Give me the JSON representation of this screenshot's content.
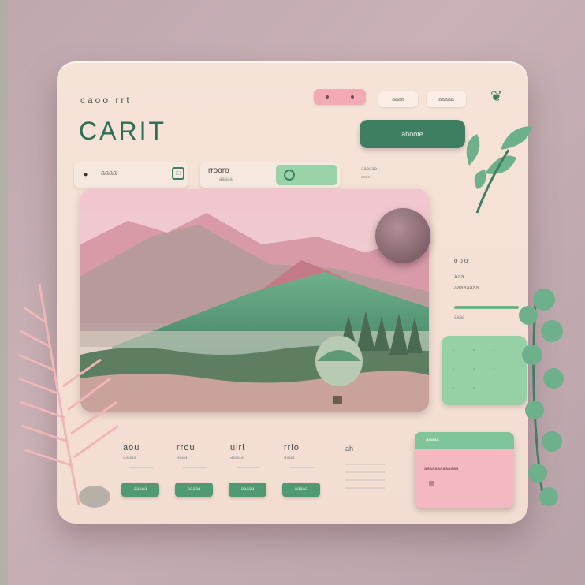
{
  "header": {
    "eyebrow": "caoo rrt",
    "brand": "CARIT",
    "cta_label": "ahoote",
    "pill_a": "aaaa",
    "pill_b": "aaaaa"
  },
  "fields": [
    {
      "label": "aaaa"
    },
    {
      "label": "rrooro",
      "sub": "aaaaa"
    },
    {
      "label": "aaaaaa",
      "sub": "aaaa"
    }
  ],
  "side": {
    "title": "ooo",
    "rows": [
      "Aaa",
      "aaaaaaaa"
    ],
    "sub": "aaaa"
  },
  "stats": [
    {
      "value": "aou",
      "sub": "aaaaa",
      "button": "aaaaa"
    },
    {
      "value": "rrou",
      "sub": "aaaa",
      "button": "aaaaa"
    },
    {
      "value": "uiri",
      "sub": "aaaaa",
      "button": "aaaaa"
    },
    {
      "value": "rrio",
      "sub": "aaaa",
      "button": "aaaaa"
    }
  ],
  "info": {
    "title": "ah"
  },
  "pink_panel": {
    "header": "aaaaa",
    "text": "aaaaaaaaaaaaa"
  },
  "colors": {
    "primary_green": "#3f7f61",
    "soft_green": "#96d1a5",
    "pink": "#f4b9c0",
    "card_bg": "#f6e3d8"
  }
}
